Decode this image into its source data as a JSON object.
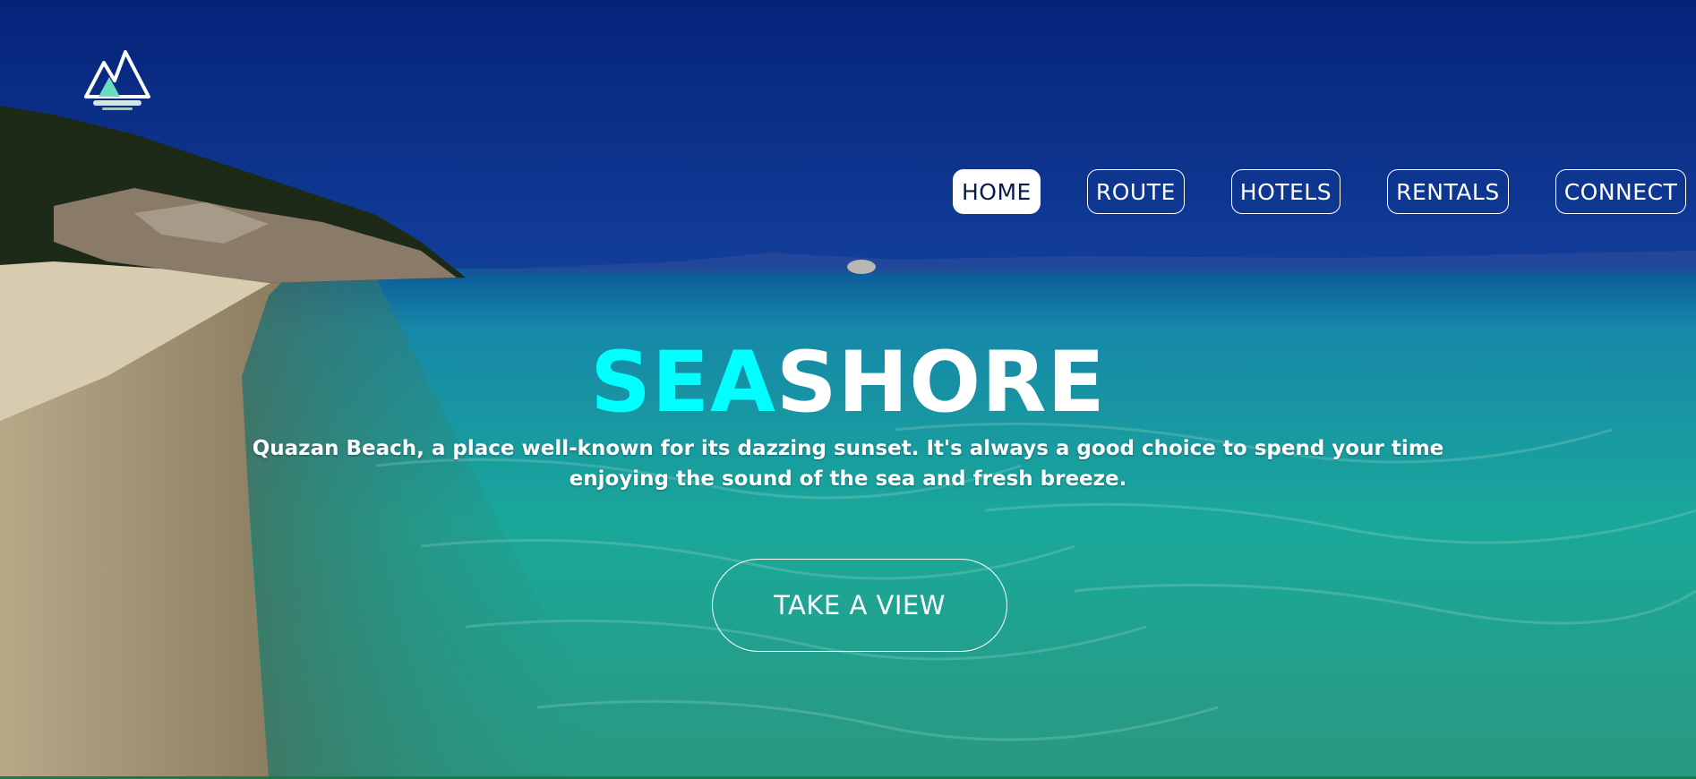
{
  "nav": {
    "items": [
      {
        "label": "HOME",
        "active": true
      },
      {
        "label": "ROUTE",
        "active": false
      },
      {
        "label": "HOTELS",
        "active": false
      },
      {
        "label": "RENTALS",
        "active": false
      },
      {
        "label": "CONNECT",
        "active": false
      }
    ]
  },
  "hero": {
    "title_part1": "SEA",
    "title_part2": "SHORE",
    "description": "Quazan Beach, a place well-known for its dazzing sunset. It's always a good choice to spend your time enjoying the sound of the sea and fresh breeze.",
    "cta_label": "TAKE A VIEW"
  },
  "colors": {
    "accent": "#00ffff",
    "text": "#ffffff",
    "sky": "#0a2a8a",
    "sea": "#1aa89a"
  },
  "icons": {
    "logo": "mountain-logo-icon"
  }
}
